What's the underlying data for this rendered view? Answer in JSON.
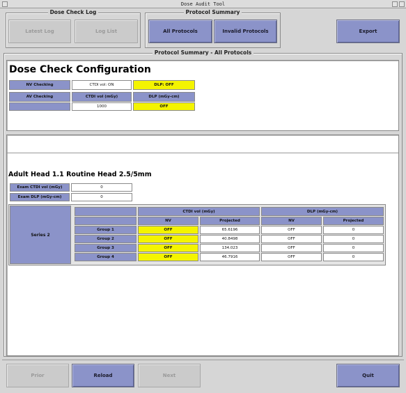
{
  "window": {
    "title": "Dose Audit Tool"
  },
  "dose_check_log": {
    "legend": "Dose Check Log",
    "latest_log": "Latest Log",
    "log_list": "Log List"
  },
  "protocol_summary": {
    "legend": "Protocol Summary",
    "all_protocols": "All Protocols",
    "invalid_protocols": "Invalid Protocols"
  },
  "export_label": "Export",
  "main_legend": "Protocol Summary - All Protocols",
  "config": {
    "title": "Dose Check Configuration",
    "nv_checking_label": "NV Checking",
    "nv_ctdi_value": "CTDI vol: ON",
    "nv_dlp_value": "DLP: OFF",
    "av_checking_label": "AV Checking",
    "ctdi_header": "CTDI vol (mGy)",
    "dlp_header": "DLP (mGy-cm)",
    "av_ctdi_value": "1000",
    "av_dlp_value": "OFF"
  },
  "protocol": {
    "name": "Adult Head 1.1 Routine Head 2.5/5mm",
    "exam_ctdi_label": "Exam CTDI vol (mGy)",
    "exam_ctdi_value": "0",
    "exam_dlp_label": "Exam DLP (mGy-cm)",
    "exam_dlp_value": "0",
    "series_label": "Series 2",
    "ctdi_header": "CTDI vol (mGy)",
    "dlp_header": "DLP (mGy-cm)",
    "nv_header": "NV",
    "projected_header": "Projected",
    "dlp_nv_header": "NV",
    "dlp_projected_header": "Projected",
    "groups": [
      {
        "name": "Group 1",
        "ctdi_nv": "OFF",
        "ctdi_projected": "65.6196",
        "dlp_nv": "OFF",
        "dlp_projected": "0"
      },
      {
        "name": "Group 2",
        "ctdi_nv": "OFF",
        "ctdi_projected": "40.8498",
        "dlp_nv": "OFF",
        "dlp_projected": "0"
      },
      {
        "name": "Group 3",
        "ctdi_nv": "OFF",
        "ctdi_projected": "134.023",
        "dlp_nv": "OFF",
        "dlp_projected": "0"
      },
      {
        "name": "Group 4",
        "ctdi_nv": "OFF",
        "ctdi_projected": "46.7916",
        "dlp_nv": "OFF",
        "dlp_projected": "0"
      }
    ]
  },
  "bottom": {
    "prior": "Prior",
    "reload": "Reload",
    "next": "Next",
    "quit": "Quit"
  },
  "colors": {
    "accent": "#8b93c9",
    "highlight": "#f4f400",
    "background": "#d6d6d6"
  }
}
